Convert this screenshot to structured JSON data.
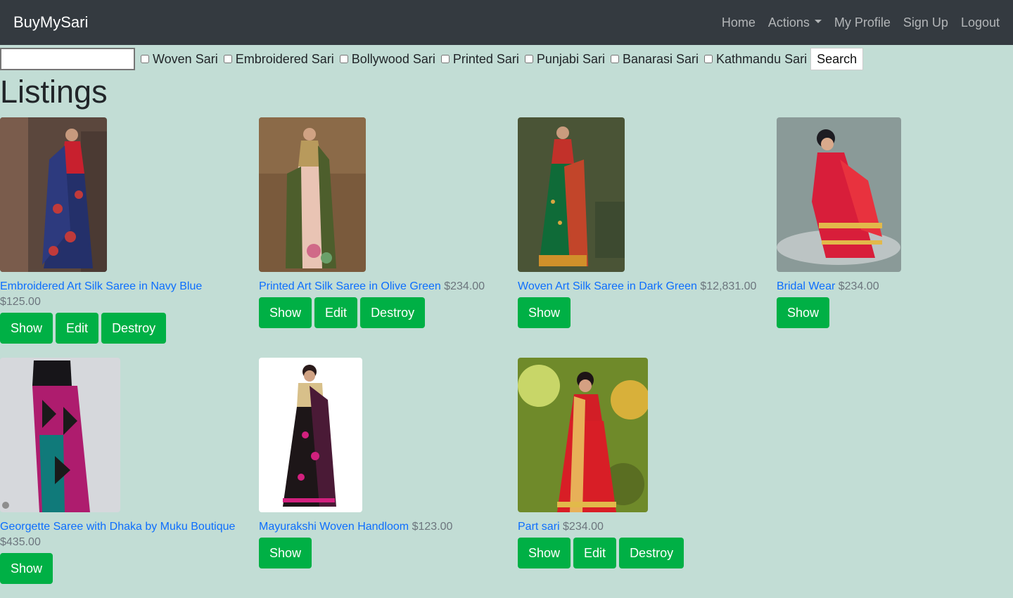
{
  "nav": {
    "brand": "BuyMySari",
    "links": [
      "Home",
      "Actions",
      "My Profile",
      "Sign Up",
      "Logout"
    ]
  },
  "filters": {
    "search_value": "",
    "categories": [
      "Woven Sari",
      "Embroidered Sari",
      "Bollywood Sari",
      "Printed Sari",
      "Punjabi Sari",
      "Banarasi Sari",
      "Kathmandu Sari"
    ],
    "search_label": "Search"
  },
  "page_title": "Listings",
  "listings": [
    {
      "title": "Embroidered Art Silk Saree in Navy Blue",
      "price": "$125.00",
      "buttons": [
        "Show",
        "Edit",
        "Destroy"
      ]
    },
    {
      "title": "Printed Art Silk Saree in Olive Green",
      "price": "$234.00",
      "buttons": [
        "Show",
        "Edit",
        "Destroy"
      ]
    },
    {
      "title": "Woven Art Silk Saree in Dark Green",
      "price": "$12,831.00",
      "buttons": [
        "Show"
      ]
    },
    {
      "title": "Bridal Wear",
      "price": "$234.00",
      "buttons": [
        "Show"
      ]
    },
    {
      "title": "Georgette Saree with Dhaka by Muku Boutique",
      "price": "$435.00",
      "buttons": [
        "Show"
      ]
    },
    {
      "title": "Mayurakshi Woven Handloom",
      "price": "$123.00",
      "buttons": [
        "Show"
      ]
    },
    {
      "title": "Part sari",
      "price": "$234.00",
      "buttons": [
        "Show",
        "Edit",
        "Destroy"
      ]
    }
  ],
  "colors": {
    "background": "#c2ddd5",
    "navbar": "#343a40",
    "button": "#00b045",
    "link": "#0d6efd"
  }
}
